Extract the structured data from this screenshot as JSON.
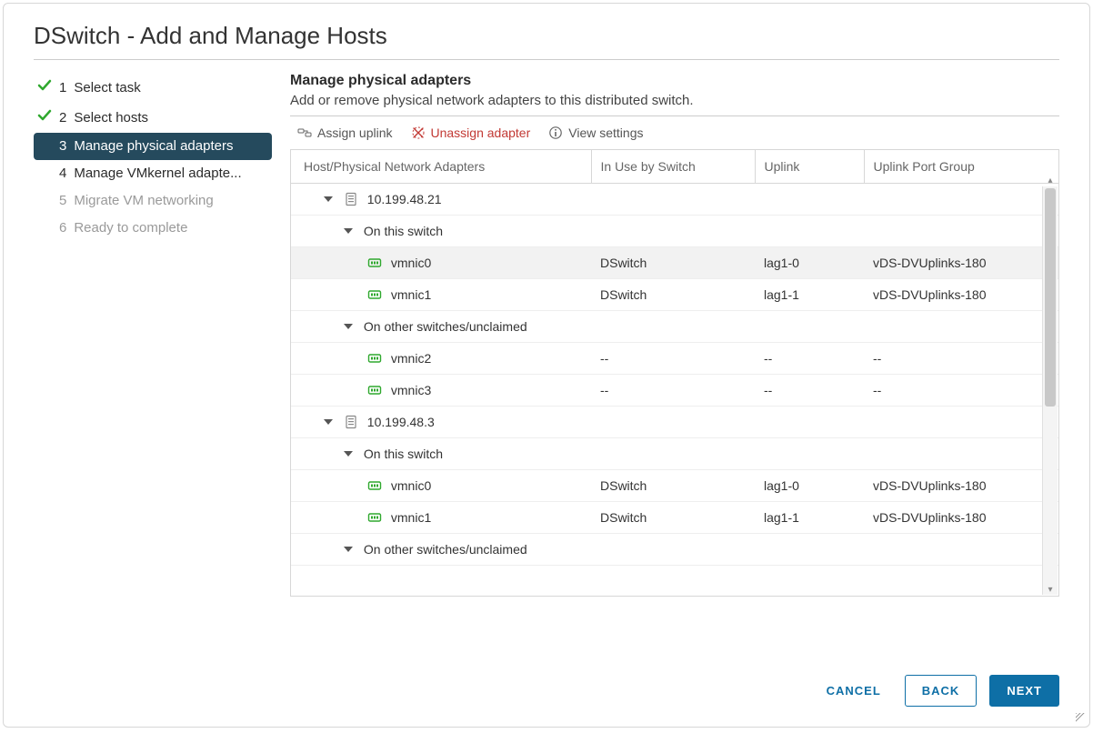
{
  "dialog": {
    "title": "DSwitch - Add and Manage Hosts"
  },
  "wizard": {
    "steps": [
      {
        "index": "1",
        "label": "Select task"
      },
      {
        "index": "2",
        "label": "Select hosts"
      },
      {
        "index": "3",
        "label": "Manage physical adapters"
      },
      {
        "index": "4",
        "label": "Manage VMkernel adapte..."
      },
      {
        "index": "5",
        "label": "Migrate VM networking"
      },
      {
        "index": "6",
        "label": "Ready to complete"
      }
    ]
  },
  "main": {
    "heading": "Manage physical adapters",
    "subtitle": "Add or remove physical network adapters to this distributed switch.",
    "toolbar": {
      "assign": "Assign uplink",
      "unassign": "Unassign adapter",
      "view": "View settings"
    },
    "columns": {
      "c0": "Host/Physical Network Adapters",
      "c1": "In Use by Switch",
      "c2": "Uplink",
      "c3": "Uplink Port Group"
    },
    "groups": {
      "on_this_switch": "On this switch",
      "on_other": "On other switches/unclaimed"
    },
    "hosts": [
      {
        "ip": "10.199.48.21",
        "on_switch": [
          {
            "name": "vmnic0",
            "sw": "DSwitch",
            "uplink": "lag1-0",
            "pg": "vDS-DVUplinks-180"
          },
          {
            "name": "vmnic1",
            "sw": "DSwitch",
            "uplink": "lag1-1",
            "pg": "vDS-DVUplinks-180"
          }
        ],
        "other": [
          {
            "name": "vmnic2",
            "sw": "--",
            "uplink": "--",
            "pg": "--"
          },
          {
            "name": "vmnic3",
            "sw": "--",
            "uplink": "--",
            "pg": "--"
          }
        ]
      },
      {
        "ip": "10.199.48.3",
        "on_switch": [
          {
            "name": "vmnic0",
            "sw": "DSwitch",
            "uplink": "lag1-0",
            "pg": "vDS-DVUplinks-180"
          },
          {
            "name": "vmnic1",
            "sw": "DSwitch",
            "uplink": "lag1-1",
            "pg": "vDS-DVUplinks-180"
          }
        ],
        "other": []
      }
    ]
  },
  "footer": {
    "cancel": "CANCEL",
    "back": "BACK",
    "next": "NEXT"
  }
}
